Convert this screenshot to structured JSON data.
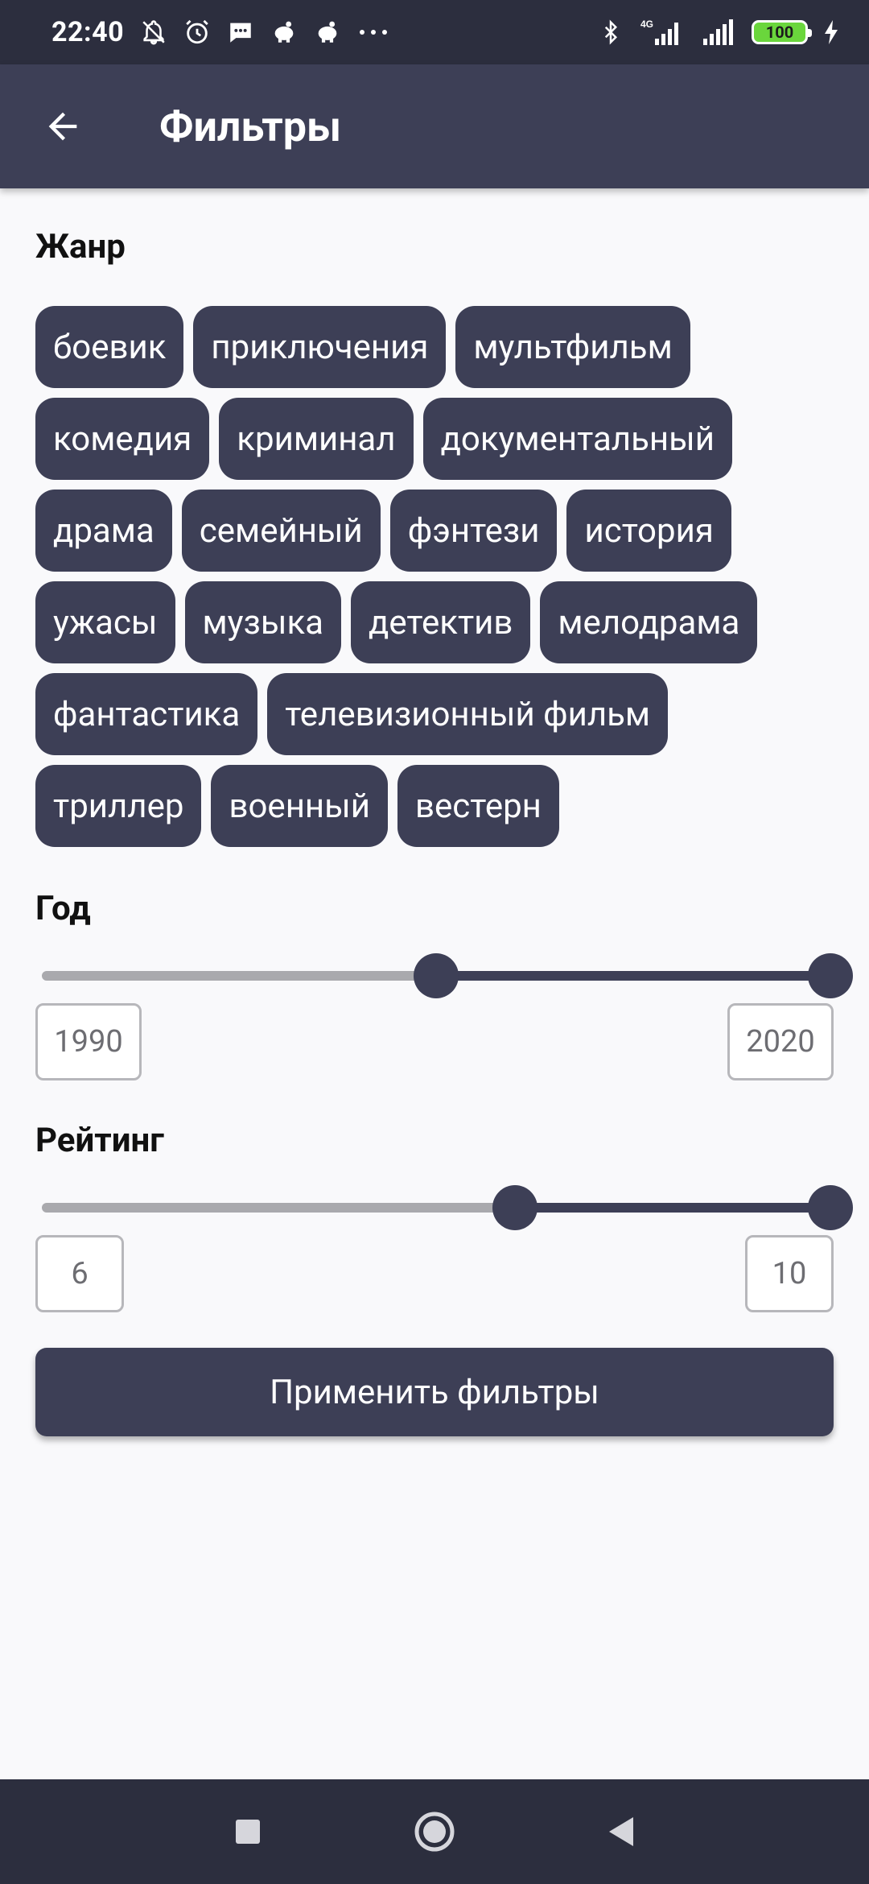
{
  "status_bar": {
    "time": "22:40",
    "battery": "100",
    "network": "4G",
    "icons_left": [
      "notifications-off-icon",
      "alarm-icon",
      "message-icon",
      "piggy-bank-icon",
      "piggy-bank-icon",
      "more-icon"
    ],
    "icons_right": [
      "bluetooth-icon",
      "signal-4g-icon",
      "signal-icon",
      "battery-icon",
      "charging-icon"
    ]
  },
  "app_bar": {
    "title": "Фильтры",
    "back_icon": "arrow-back-icon"
  },
  "genre": {
    "title": "Жанр",
    "chips": [
      "боевик",
      "приключения",
      "мультфильм",
      "комедия",
      "криминал",
      "документальный",
      "драма",
      "семейный",
      "фэнтези",
      "история",
      "ужасы",
      "музыка",
      "детектив",
      "мелодрама",
      "фантастика",
      "телевизионный фильм",
      "триллер",
      "военный",
      "вестерн"
    ]
  },
  "year": {
    "title": "Год",
    "min_value": "1990",
    "max_value": "2020",
    "selected_start_fraction": 0.5,
    "selected_end_fraction": 1.0
  },
  "rating": {
    "title": "Рейтинг",
    "min_value": "6",
    "max_value": "10",
    "selected_start_fraction": 0.6,
    "selected_end_fraction": 1.0
  },
  "apply_button": {
    "label": "Применить фильтры"
  },
  "nav_bar": {
    "items": [
      "recents-square-icon",
      "home-circle-icon",
      "back-triangle-icon"
    ]
  },
  "colors": {
    "primary": "#3d3f56",
    "status_bar": "#2c2e3e",
    "background": "#f9f9fb",
    "track_inactive": "#a9a9ad",
    "battery": "#6ad63c"
  }
}
